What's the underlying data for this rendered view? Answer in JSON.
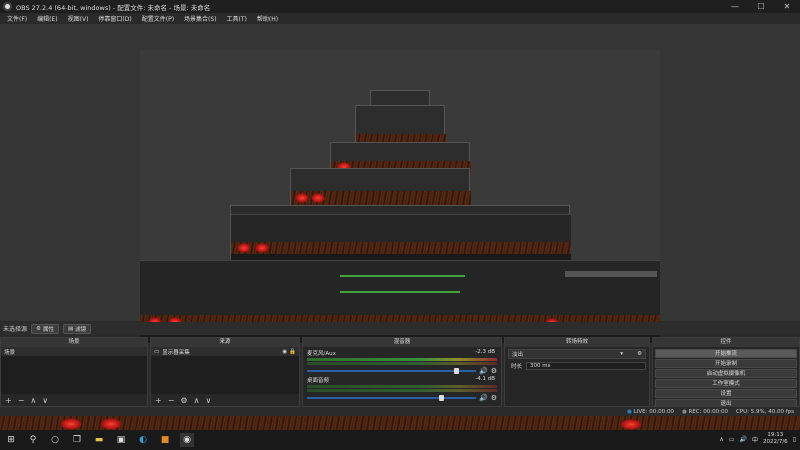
{
  "window": {
    "title": "OBS 27.2.4 (64-bit, windows) - 配置文件: 未命名 - 场景: 未命名",
    "controls": [
      "—",
      "☐",
      "✕"
    ]
  },
  "menu": [
    "文件(F)",
    "编辑(E)",
    "视图(V)",
    "停靠窗口(D)",
    "配置文件(P)",
    "场景集合(S)",
    "工具(T)",
    "帮助(H)"
  ],
  "scene_info": {
    "label": "未选择源",
    "properties_button": "属性",
    "filters_button": "滤镜"
  },
  "scenes": {
    "header": "场景",
    "items": [
      "场景"
    ]
  },
  "sources": {
    "header": "来源",
    "items": [
      "显示器采集"
    ]
  },
  "mixer": {
    "header": "混音器",
    "channels": [
      {
        "name": "麦克风/Aux",
        "db": "-2.3 dB",
        "level": 0.87
      },
      {
        "name": "桌面音频",
        "db": "-4.1 dB",
        "level": 0.78
      }
    ]
  },
  "transitions": {
    "header": "转场特效",
    "selected": "淡出",
    "duration_label": "时长",
    "duration_value": "300 ms"
  },
  "controls": {
    "header": "控件",
    "buttons": [
      "开始推流",
      "开始录制",
      "启动虚拟摄像机",
      "工作室模式",
      "设置",
      "退出"
    ]
  },
  "status": {
    "live_label": "LIVE",
    "live_time": "00:00:00",
    "rec_label": "REC",
    "rec_time": "00:00:00",
    "cpu": "CPU: 5.9%, 40.00 fps"
  },
  "taskbar": {
    "time": "19:13",
    "date": "2022/7/6",
    "ime": "中"
  },
  "colors": {
    "accent": "#2a5fa8",
    "meter_green": "#3fa43f",
    "meter_red": "#a03030",
    "live_dot": "#2a7fc0"
  }
}
